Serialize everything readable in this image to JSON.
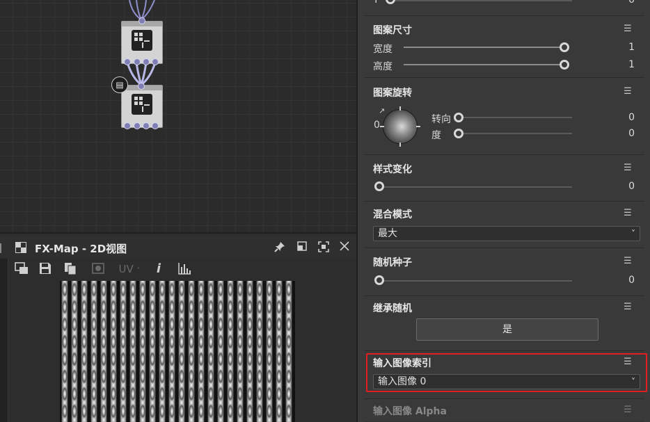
{
  "graph": {
    "node_badge_icon": "document-icon"
  },
  "view_panel": {
    "title": "FX-Map - 2D视图",
    "title_icon": "tile-icon",
    "pin_icon": "pin-icon",
    "maximize_icon": "maximize-icon",
    "fit_icon": "fit-view-icon",
    "close_icon": "close-icon",
    "toolbar": {
      "uv_label": "UV",
      "info_label": "i"
    }
  },
  "props": {
    "top_row": {
      "label": "Y",
      "value": "0"
    },
    "pattern_size": {
      "title": "图案尺寸",
      "width_label": "宽度",
      "width_value": "1",
      "height_label": "高度",
      "height_value": "1"
    },
    "pattern_rotation": {
      "title": "图案旋转",
      "dial_value": "0",
      "turn_label": "转向",
      "turn_value": "0",
      "degree_label": "度",
      "degree_value": "0"
    },
    "style_variation": {
      "title": "样式变化",
      "value": "0"
    },
    "blend_mode": {
      "title": "混合模式",
      "selected": "最大"
    },
    "random_seed": {
      "title": "随机种子",
      "value": "0"
    },
    "inherit_random": {
      "title": "继承随机",
      "button_label": "是"
    },
    "input_image_index": {
      "title": "输入图像索引",
      "selected": "输入图像 0"
    },
    "input_image_alpha": {
      "title": "输入图像 Alpha"
    }
  },
  "colors": {
    "highlight": "#e02020",
    "port": "#7f7fb5"
  }
}
